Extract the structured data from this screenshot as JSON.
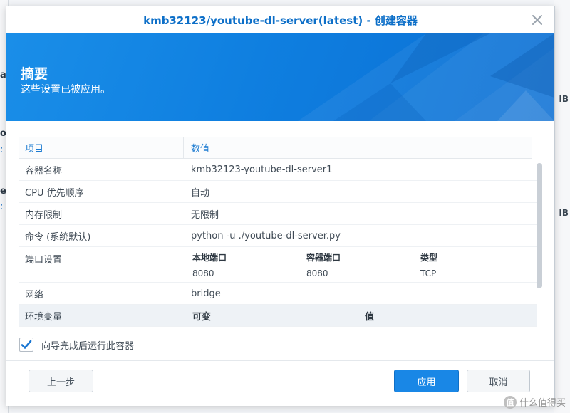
{
  "background": {
    "left_fragments": [
      "a",
      "ol",
      ":",
      "e",
      ":"
    ],
    "right_units": [
      "IB",
      "IB"
    ]
  },
  "dialog": {
    "title": "kmb32123/youtube-dl-server(latest) - 创建容器",
    "close_icon": "close-icon",
    "banner": {
      "heading": "摘要",
      "subtitle": "这些设置已被应用。"
    },
    "table": {
      "headers": {
        "item": "项目",
        "value": "数值"
      },
      "rows": [
        {
          "item": "容器名称",
          "value": "kmb32123-youtube-dl-server1"
        },
        {
          "item": "CPU 优先顺序",
          "value": "自动"
        },
        {
          "item": "内存限制",
          "value": "无限制"
        },
        {
          "item": "命令 (系统默认)",
          "value": "python -u ./youtube-dl-server.py"
        }
      ],
      "ports": {
        "item": "端口设置",
        "headers": {
          "local": "本地端口",
          "container": "容器端口",
          "type": "类型"
        },
        "values": {
          "local": "8080",
          "container": "8080",
          "type": "TCP"
        }
      },
      "network": {
        "item": "网络",
        "value": "bridge"
      },
      "env": {
        "item": "环境变量",
        "headers": {
          "variable": "可变",
          "value": "值"
        }
      }
    },
    "checkbox": {
      "label": "向导完成后运行此容器",
      "checked": true
    },
    "buttons": {
      "prev": "上一步",
      "apply": "应用",
      "cancel": "取消"
    }
  },
  "watermark": {
    "glyph": "值",
    "text": "什么值得买"
  },
  "colors": {
    "accent": "#0d6fc8",
    "banner": "#1987e6",
    "apply_button": "#1987e6"
  }
}
